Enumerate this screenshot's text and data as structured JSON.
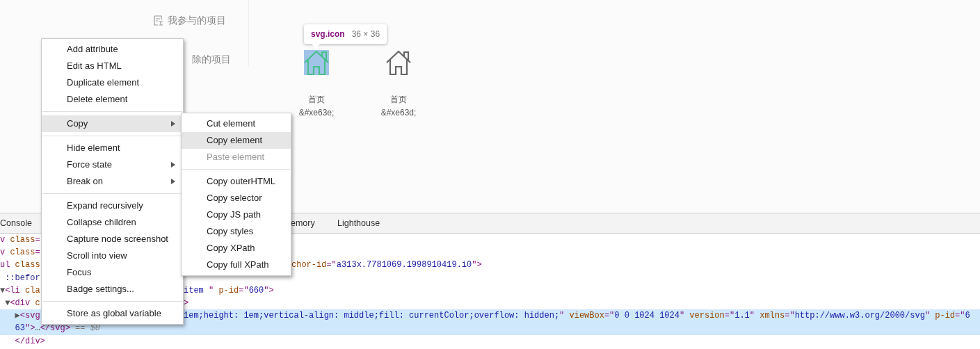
{
  "sidebar": {
    "items": [
      {
        "label": "我参与的项目",
        "has_icon": true
      },
      {
        "label": "除的项目",
        "has_icon": false
      }
    ]
  },
  "icons": [
    {
      "label": "首页",
      "code": "&#xe63e;",
      "selected": true
    },
    {
      "label": "首页",
      "code": "&#xe63d;",
      "selected": false
    }
  ],
  "tooltip": {
    "selector": "svg.icon",
    "size": "36 × 36"
  },
  "devtools": {
    "tabs": [
      {
        "label": "Console"
      },
      {
        "label": "emory"
      },
      {
        "label": "Lighthouse"
      }
    ],
    "lines": [
      {
        "selected": false,
        "kind": "whole",
        "left": [
          {
            "kind": "tag",
            "text": "v"
          },
          {
            "kind": "attr",
            "text": " class"
          },
          {
            "kind": "tag",
            "text": "="
          }
        ]
      },
      {
        "selected": false,
        "kind": "whole",
        "left": [
          {
            "kind": "tag",
            "text": "v"
          },
          {
            "kind": "attr",
            "text": " class"
          },
          {
            "kind": "tag",
            "text": "="
          }
        ]
      },
      {
        "selected": false,
        "kind": "split_submenu",
        "left": [
          {
            "kind": "tag",
            "text": "ul"
          },
          {
            "kind": "attr",
            "text": " class"
          }
        ],
        "right": [
          {
            "kind": "attr",
            "text": "chor-id"
          },
          {
            "kind": "tag",
            "text": "=\""
          },
          {
            "kind": "value",
            "text": "a313x.7781069.1998910419.i0"
          },
          {
            "kind": "tag",
            "text": "\">"
          }
        ]
      },
      {
        "selected": false,
        "kind": "whole",
        "left": [
          {
            "kind": "pseudo",
            "text": " ::befor"
          }
        ]
      },
      {
        "selected": false,
        "kind": "split_menu",
        "left": [
          {
            "kind": "arrow",
            "text": "▼"
          },
          {
            "kind": "tag",
            "text": "<li"
          },
          {
            "kind": "attr",
            "text": " cla"
          }
        ],
        "right": [
          {
            "kind": "value",
            "text": "item "
          },
          {
            "kind": "tag",
            "text": "\" "
          },
          {
            "kind": "attr",
            "text": "p-id"
          },
          {
            "kind": "tag",
            "text": "=\""
          },
          {
            "kind": "value",
            "text": "660"
          },
          {
            "kind": "tag",
            "text": "\">"
          }
        ]
      },
      {
        "selected": false,
        "kind": "split_menu",
        "left": [
          {
            "kind": "arrow",
            "text": " ▼"
          },
          {
            "kind": "tag",
            "text": "<div"
          },
          {
            "kind": "attr",
            "text": " c"
          }
        ],
        "right": [
          {
            "kind": "tag",
            "text": ">"
          }
        ]
      },
      {
        "selected": true,
        "kind": "split_menu",
        "left": [
          {
            "kind": "arrow",
            "text": "   ▶"
          },
          {
            "kind": "tag",
            "text": "<svg"
          }
        ],
        "right": [
          {
            "kind": "value",
            "text": "1em;height: 1em;vertical-align: middle;fill: currentColor;overflow: hidden;"
          },
          {
            "kind": "tag",
            "text": "\" "
          },
          {
            "kind": "attr",
            "text": "viewBox"
          },
          {
            "kind": "tag",
            "text": "=\""
          },
          {
            "kind": "value",
            "text": "0 0 1024 1024"
          },
          {
            "kind": "tag",
            "text": "\" "
          },
          {
            "kind": "attr",
            "text": "version"
          },
          {
            "kind": "tag",
            "text": "=\""
          },
          {
            "kind": "value",
            "text": "1.1"
          },
          {
            "kind": "tag",
            "text": "\" "
          },
          {
            "kind": "attr",
            "text": "xmlns"
          },
          {
            "kind": "tag",
            "text": "=\""
          },
          {
            "kind": "value",
            "text": "http://www.w3.org/2000/svg"
          },
          {
            "kind": "tag",
            "text": "\" "
          },
          {
            "kind": "attr",
            "text": "p-id"
          },
          {
            "kind": "tag",
            "text": "=\""
          },
          {
            "kind": "value",
            "text": "6"
          }
        ]
      },
      {
        "selected": true,
        "kind": "whole",
        "left": [
          {
            "kind": "value",
            "text": "   63"
          },
          {
            "kind": "tag",
            "text": "\">"
          },
          {
            "kind": "plain",
            "text": "…"
          },
          {
            "kind": "tag",
            "text": "</svg>"
          },
          {
            "kind": "muted",
            "text": " == $0"
          }
        ]
      },
      {
        "selected": false,
        "kind": "whole",
        "left": [
          {
            "kind": "tag",
            "text": "   </div>"
          }
        ]
      }
    ]
  },
  "context_menu": {
    "items": [
      {
        "kind": "item",
        "label": "Add attribute",
        "selected": false,
        "disabled": false,
        "has_submenu": false
      },
      {
        "kind": "item",
        "label": "Edit as HTML",
        "selected": false,
        "disabled": false,
        "has_submenu": false
      },
      {
        "kind": "item",
        "label": "Duplicate element",
        "selected": false,
        "disabled": false,
        "has_submenu": false
      },
      {
        "kind": "item",
        "label": "Delete element",
        "selected": false,
        "disabled": false,
        "has_submenu": false
      },
      {
        "kind": "separator"
      },
      {
        "kind": "item",
        "label": "Copy",
        "selected": true,
        "disabled": false,
        "has_submenu": true
      },
      {
        "kind": "separator"
      },
      {
        "kind": "item",
        "label": "Hide element",
        "selected": false,
        "disabled": false,
        "has_submenu": false
      },
      {
        "kind": "item",
        "label": "Force state",
        "selected": false,
        "disabled": false,
        "has_submenu": true
      },
      {
        "kind": "item",
        "label": "Break on",
        "selected": false,
        "disabled": false,
        "has_submenu": true
      },
      {
        "kind": "separator"
      },
      {
        "kind": "item",
        "label": "Expand recursively",
        "selected": false,
        "disabled": false,
        "has_submenu": false
      },
      {
        "kind": "item",
        "label": "Collapse children",
        "selected": false,
        "disabled": false,
        "has_submenu": false
      },
      {
        "kind": "item",
        "label": "Capture node screenshot",
        "selected": false,
        "disabled": false,
        "has_submenu": false
      },
      {
        "kind": "item",
        "label": "Scroll into view",
        "selected": false,
        "disabled": false,
        "has_submenu": false
      },
      {
        "kind": "item",
        "label": "Focus",
        "selected": false,
        "disabled": false,
        "has_submenu": false
      },
      {
        "kind": "item",
        "label": "Badge settings...",
        "selected": false,
        "disabled": false,
        "has_submenu": false
      },
      {
        "kind": "separator"
      },
      {
        "kind": "item",
        "label": "Store as global variable",
        "selected": false,
        "disabled": false,
        "has_submenu": false
      }
    ]
  },
  "submenu": {
    "items": [
      {
        "kind": "item",
        "label": "Cut element",
        "selected": false,
        "disabled": false,
        "has_submenu": false
      },
      {
        "kind": "item",
        "label": "Copy element",
        "selected": true,
        "disabled": false,
        "has_submenu": false
      },
      {
        "kind": "item",
        "label": "Paste element",
        "selected": false,
        "disabled": true,
        "has_submenu": false
      },
      {
        "kind": "separator"
      },
      {
        "kind": "item",
        "label": "Copy outerHTML",
        "selected": false,
        "disabled": false,
        "has_submenu": false
      },
      {
        "kind": "item",
        "label": "Copy selector",
        "selected": false,
        "disabled": false,
        "has_submenu": false
      },
      {
        "kind": "item",
        "label": "Copy JS path",
        "selected": false,
        "disabled": false,
        "has_submenu": false
      },
      {
        "kind": "item",
        "label": "Copy styles",
        "selected": false,
        "disabled": false,
        "has_submenu": false
      },
      {
        "kind": "item",
        "label": "Copy XPath",
        "selected": false,
        "disabled": false,
        "has_submenu": false
      },
      {
        "kind": "item",
        "label": "Copy full XPath",
        "selected": false,
        "disabled": false,
        "has_submenu": false
      }
    ]
  }
}
